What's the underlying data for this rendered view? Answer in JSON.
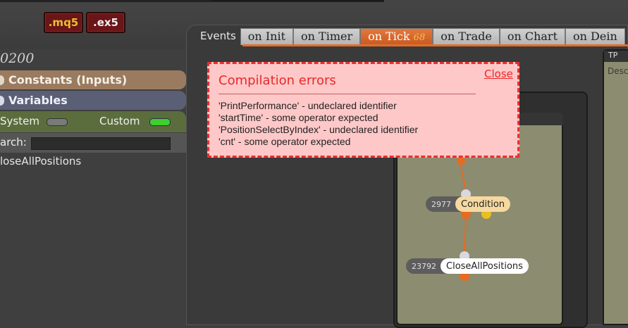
{
  "toolbar": {
    "mq5_label": ".mq5",
    "ex5_label": ".ex5"
  },
  "left": {
    "project_title": "0200",
    "constants_label": "Constants (Inputs)",
    "variables_label": "Variables",
    "system_label": "System",
    "custom_label": "Custom",
    "search_label": "arch:",
    "search_value": "",
    "list_items": [
      "loseAllPositions"
    ]
  },
  "tabs": {
    "events_label": "Events",
    "items": [
      {
        "label": "on Init"
      },
      {
        "label": "on Timer"
      },
      {
        "label": "on Tick",
        "badge": "68"
      },
      {
        "label": "on Trade"
      },
      {
        "label": "on Chart"
      },
      {
        "label": "on Dein"
      }
    ],
    "active": "on Tick"
  },
  "canvas": {
    "tp_label": "TP",
    "desc_label": "Desc",
    "nodes": [
      {
        "id": "2977",
        "name": "Condition"
      },
      {
        "id": "23792",
        "name": "CloseAllPositions"
      }
    ]
  },
  "error_popup": {
    "title": "Compilation errors",
    "close_label": "Close",
    "errors": [
      "'PrintPerformance' - undeclared identifier",
      "'startTime' - some operator expected",
      "'PositionSelectByIndex' - undeclared identifier",
      "'cnt' - some operator expected"
    ]
  },
  "colors": {
    "accent": "#e36d2a",
    "error": "#e82828",
    "error_bg": "#ffc8c8",
    "toggle_on": "#3ecf2e"
  }
}
